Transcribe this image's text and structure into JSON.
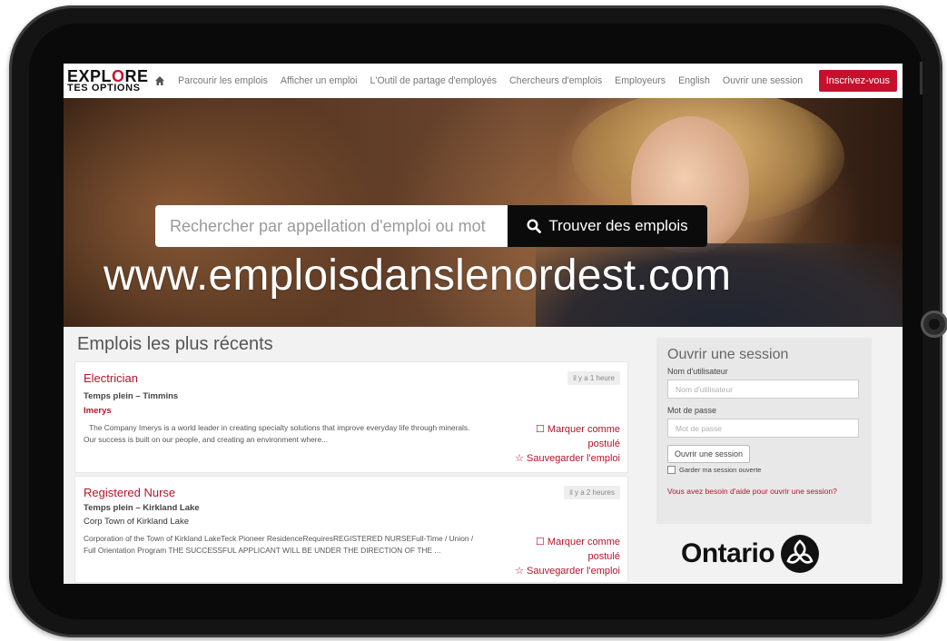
{
  "watermark": "www.emploisdanslenordest.com",
  "brand": {
    "logo_top": "EXPL",
    "logo_o": "O",
    "logo_top_end": "RE",
    "logo_bottom": "TES OPTIONS",
    "accent": "#c8102e"
  },
  "nav": {
    "links": [
      "Parcourir les emplois",
      "Afficher un emploi",
      "L'Outil de partage d'employés",
      "Chercheurs d'emplois",
      "Employeurs",
      "English",
      "Ouvrir une session"
    ],
    "cta": "Inscrivez-vous"
  },
  "search": {
    "placeholder": "Rechercher par appellation d'emploi ou mot",
    "button": "Trouver des emplois"
  },
  "recent": {
    "title": "Emplois les plus récents",
    "jobs": [
      {
        "title": "Electrician",
        "time": "il y a 1 heure",
        "type": "Temps plein – Timmins",
        "company": "Imerys",
        "description": "The Company Imerys is a world leader in creating specialty solutions that improve everyday life through minerals. Our success is built on our people, and creating an environment where...",
        "mark_label": "Marquer comme",
        "mark_label_2": "postulé",
        "save_label": "Sauvegarder l'emploi"
      },
      {
        "title": "Registered Nurse",
        "time": "il y a 2 heures",
        "type": "Temps plein – Kirkland Lake",
        "company": "Corp Town of Kirkland Lake",
        "description": "Corporation of the Town of Kirkland LakeTeck Pioneer ResidenceRequiresREGISTERED NURSEFull-Time / Union / Full Orientation Program THE SUCCESSFUL APPLICANT WILL BE UNDER THE DIRECTION OF THE ...",
        "mark_label": "Marquer comme",
        "mark_label_2": "postulé",
        "save_label": "Sauvegarder l'emploi"
      }
    ]
  },
  "login": {
    "title": "Ouvrir une session",
    "username_label": "Nom d'utilisateur",
    "username_placeholder": "Nom d'utilisateur",
    "password_label": "Mot de passe",
    "password_placeholder": "Mot de passe",
    "submit": "Ouvrir une session",
    "remember": "Garder ma session ouverte",
    "help": "Vous avez besoin d'aide pour ouvrir une session?"
  },
  "ontario": {
    "wordmark": "Ontario"
  }
}
